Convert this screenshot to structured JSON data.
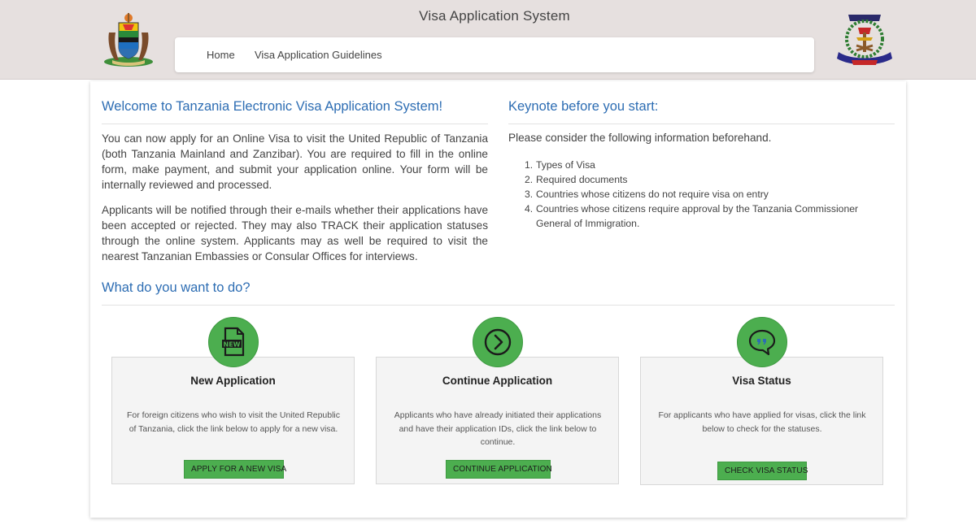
{
  "header": {
    "title": "Visa Application System",
    "nav": {
      "home": "Home",
      "guidelines": "Visa Application Guidelines"
    },
    "left_logo": "tanzania-coat-of-arms-icon",
    "right_logo": "tanzania-immigration-emblem-icon"
  },
  "welcome": {
    "title": "Welcome to Tanzania Electronic Visa Application System!",
    "paragraph1": "You can now apply for an Online Visa to visit the United Republic of Tanzania (both Tanzania Mainland and Zanzibar). You are required to fill in the online form, make payment, and submit your application online. Your form will be internally reviewed and processed.",
    "paragraph2": "Applicants will be notified through their e-mails whether their applications have been accepted or rejected. They may also TRACK their application statuses through the online system. Applicants may as well be required to visit the nearest Tanzanian Embassies or Consular Offices for interviews."
  },
  "keynote": {
    "title": "Keynote before you start:",
    "intro": "Please consider the following information beforehand.",
    "items": [
      {
        "num": "1.",
        "text": "Types of Visa"
      },
      {
        "num": "2.",
        "text": "Required documents"
      },
      {
        "num": "3.",
        "text": "Countries whose citizens do not require visa on entry"
      },
      {
        "num": "4.",
        "text": "Countries whose citizens require approval by the Tanzania Commissioner General of Immigration."
      }
    ]
  },
  "actions": {
    "title": "What do you want to do?",
    "options": [
      {
        "icon": "new-document-icon",
        "title": "New Application",
        "description": "For foreign citizens who wish to visit the United Republic of Tanzania, click the link below to apply for a new visa.",
        "button": "APPLY FOR A NEW VISA"
      },
      {
        "icon": "arrow-circle-right-icon",
        "title": "Continue Application",
        "description": "Applicants who have already initiated their applications and have their application IDs, click the link below to continue.",
        "button": "CONTINUE APPLICATION"
      },
      {
        "icon": "chat-quote-icon",
        "title": "Visa Status",
        "description": "For applicants who have applied for visas, click the link below to check for the statuses.",
        "button": "CHECK VISA STATUS"
      }
    ]
  },
  "colors": {
    "accent_blue": "#2d6db3",
    "button_green": "#4cae4f",
    "header_bg": "#e6e0df"
  }
}
